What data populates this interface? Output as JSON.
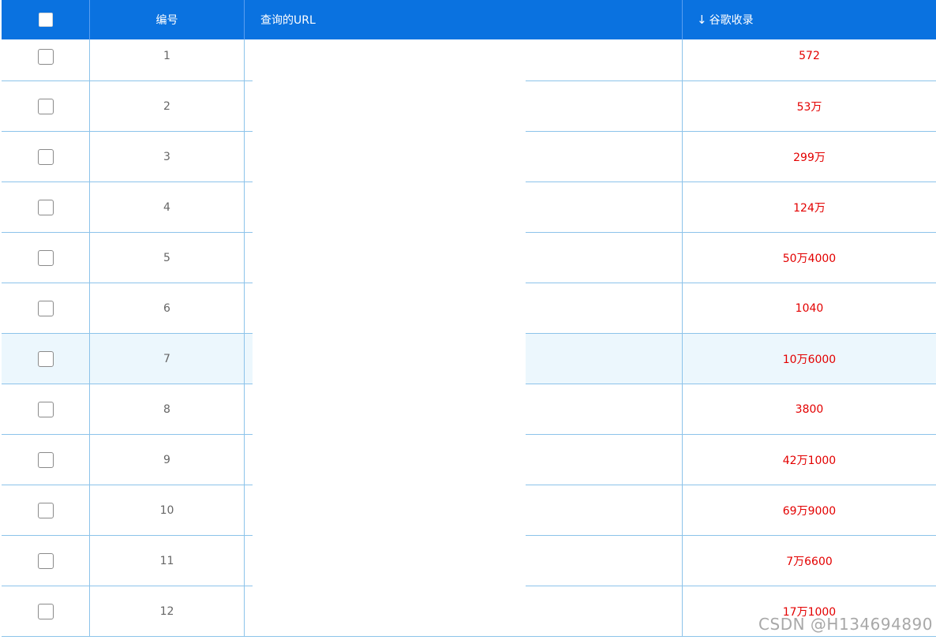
{
  "header": {
    "col_number": "编号",
    "col_url": "查询的URL",
    "col_index_arrow": "↓",
    "col_index": "谷歌收录"
  },
  "rows": [
    {
      "num": "1",
      "indexed": "572"
    },
    {
      "num": "2",
      "indexed": "53万"
    },
    {
      "num": "3",
      "indexed": "299万"
    },
    {
      "num": "4",
      "indexed": "124万"
    },
    {
      "num": "5",
      "indexed": "50万4000"
    },
    {
      "num": "6",
      "indexed": "1040"
    },
    {
      "num": "7",
      "indexed": "10万6000"
    },
    {
      "num": "8",
      "indexed": "3800"
    },
    {
      "num": "9",
      "indexed": "42万1000"
    },
    {
      "num": "10",
      "indexed": "69万9000"
    },
    {
      "num": "11",
      "indexed": "7万6600"
    },
    {
      "num": "12",
      "indexed": "17万1000"
    }
  ],
  "highlighted_row": "7",
  "watermark": "CSDN @H134694890",
  "colors": {
    "header_bg": "#0a72e0",
    "index_text": "#e30000",
    "row_border": "#8cc3ea",
    "highlight_bg": "#ecf7fd"
  }
}
